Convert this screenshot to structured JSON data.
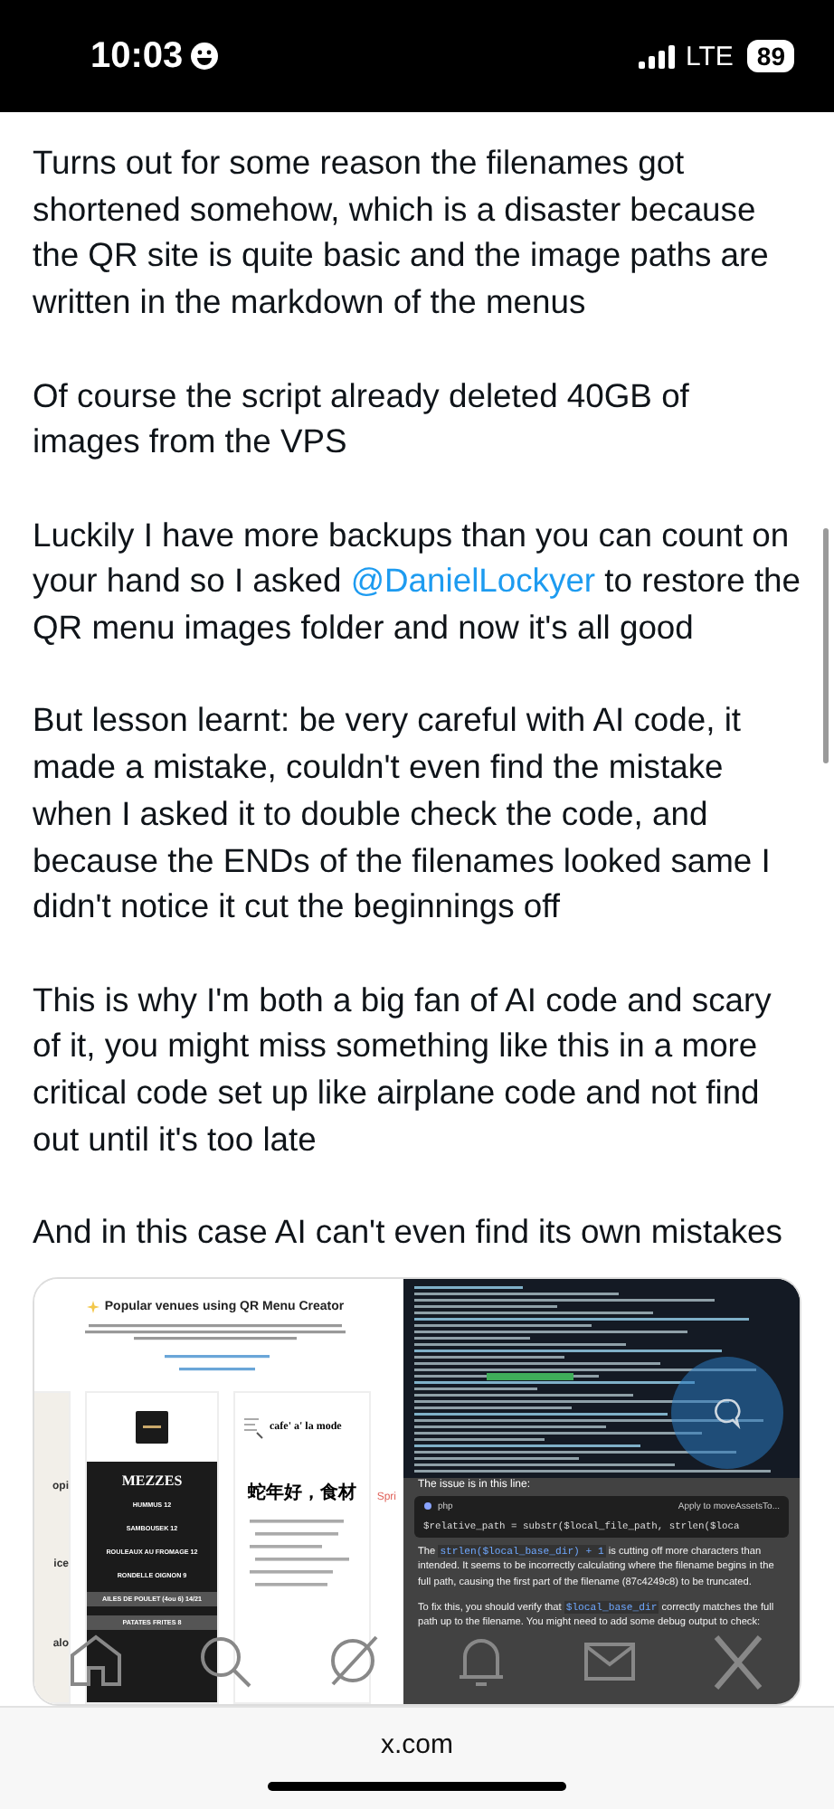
{
  "status_bar": {
    "time": "10:03",
    "network": "LTE",
    "battery": "89"
  },
  "paragraphs": [
    [
      {
        "text": "Turns out for some reason the filenames got shortened somehow, which is a disaster because the QR site is quite basic and the image paths are written in the markdown of the menus"
      }
    ],
    [
      {
        "text": "Of course the script already deleted 40GB of images from the VPS"
      }
    ],
    [
      {
        "text": "Luckily I have more backups than you can count on your hand so I asked "
      },
      {
        "text": "@DanielLockyer",
        "kind": "mention"
      },
      {
        "text": " to restore the QR menu images folder and now it's all good"
      }
    ],
    [
      {
        "text": "But lesson learnt: be very careful with AI code, it made a mistake, couldn't even find the mistake when I asked it to double check the code, and because the ENDs of the filenames looked same I didn't notice it cut the beginnings off"
      }
    ],
    [
      {
        "text": "This is why I'm both a big fan of AI code and scary of it, you might miss something like this in a more critical code set up like airplane code and not find out until it's too late"
      }
    ],
    [
      {
        "text": "And in this case AI can't even find its own mistakes"
      }
    ]
  ],
  "attachment": {
    "left_screenshot": {
      "title": "Popular venues using QR Menu Creator",
      "edge_card_texts": [
        "opi",
        "ice",
        "alo"
      ],
      "menu_card": {
        "heading": "MEZZES",
        "items": [
          {
            "text": "HUMMUS 12",
            "selected": false
          },
          {
            "text": "SAMBOUSEK 12",
            "selected": false
          },
          {
            "text": "ROULEAUX AU FROMAGE 12",
            "selected": false
          },
          {
            "text": "RONDELLE OIGNON 9",
            "selected": false
          },
          {
            "text": "AILES DE POULET (4ou 6) 14/21",
            "selected": true
          },
          {
            "text": "PATATES FRITES 8",
            "selected": true
          }
        ]
      },
      "cafe_card": {
        "name": "cafe' a' la mode",
        "heading": "蛇年好，食材"
      },
      "right_edge_text": "Spri"
    },
    "right_screenshot": {
      "issue_heading": "The issue is in this line:",
      "code_block": {
        "language": "php",
        "action": "Apply to moveAssetsTo...",
        "code": "$relative_path = substr($local_file_path, strlen($loca"
      },
      "explanation": [
        [
          {
            "text": "The "
          },
          {
            "text": "strlen($local_base_dir) + 1",
            "kind": "code"
          },
          {
            "text": " is cutting off more characters than intended. It seems to be incorrectly calculating where the filename begins in the full path, causing the first part of the filename (87c4249c8) to be truncated."
          }
        ],
        [
          {
            "text": "To fix this, you should verify that "
          },
          {
            "text": "$local_base_dir",
            "kind": "code"
          },
          {
            "text": " correctly matches the full path up to the filename. You might need to add some debug output to check:"
          }
        ]
      ]
    }
  },
  "browser_bar": {
    "url": "x.com"
  }
}
